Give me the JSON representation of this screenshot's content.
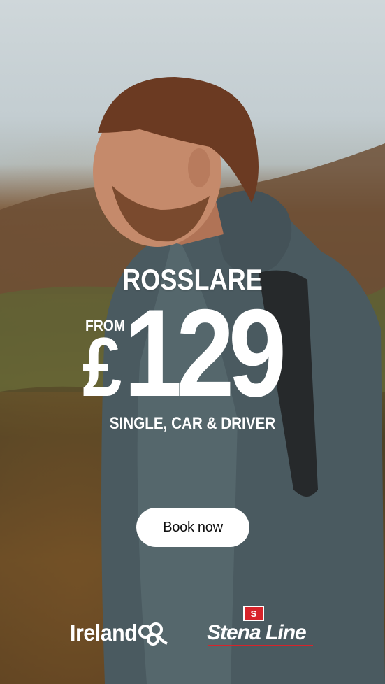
{
  "ad": {
    "destination": "ROSSLARE",
    "from_label": "FROM",
    "currency": "£",
    "price": "129",
    "subtitle": "SINGLE, CAR & DRIVER",
    "cta_label": "Book now"
  },
  "logos": {
    "ireland_text": "Ireland",
    "stena_text": "Stena Line",
    "stena_flag_letter": "S"
  },
  "colors": {
    "text": "#ffffff",
    "button_bg": "#ffffff",
    "button_text": "#111111",
    "stena_red": "#d8232a"
  }
}
